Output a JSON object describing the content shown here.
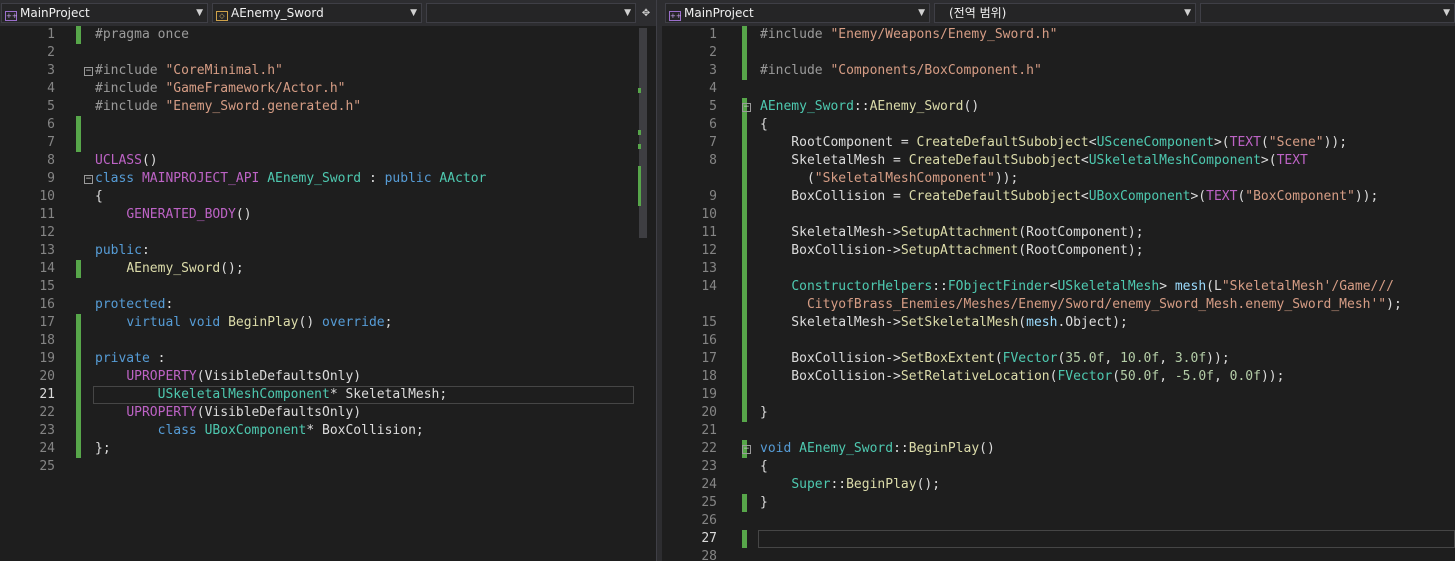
{
  "left": {
    "project": "MainProject",
    "scope": "AEnemy_Sword",
    "member": "",
    "current_line": "21"
  },
  "right": {
    "project": "MainProject",
    "scope": "(전역 범위)",
    "member": "",
    "current_line": "27"
  },
  "icons": {
    "project_icon": "cpp-project-icon",
    "class_icon": "class-scope-icon",
    "split_icon": "split-window-icon",
    "dropdown_icon": "chevron-down-icon"
  },
  "colors": {
    "keyword": "#569cd6",
    "type": "#4ec9b0",
    "string": "#d69d85",
    "macro": "#bd63c5",
    "function": "#dcdcaa",
    "preprocessor": "#9b9b9b",
    "variable": "#9cdcfe",
    "number": "#b5cea8",
    "change_marker": "#57a64a"
  }
}
